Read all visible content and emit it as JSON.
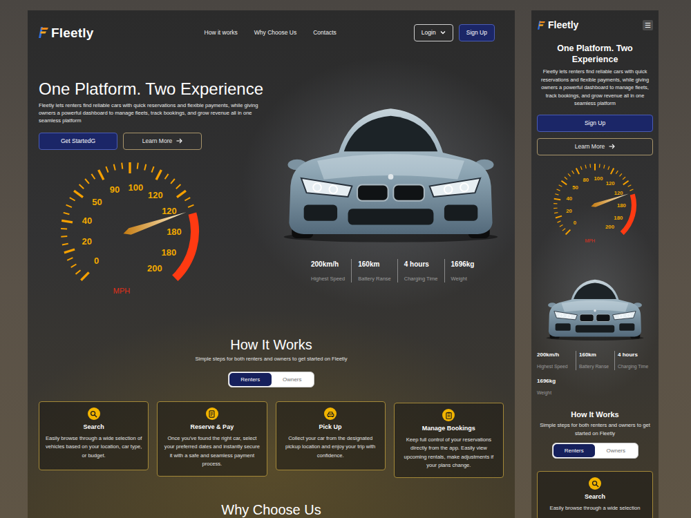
{
  "desktop": {
    "brand": "Fleetly",
    "nav_links": [
      "How it works",
      "Why Choose Us",
      "Contacts"
    ],
    "login_button": "Login",
    "signup_button": "Sign Up",
    "hero": {
      "title": "One Platform. Two Experience",
      "description": "Fleetly lets renters find reliable cars with quick reservations and flexible payments, while giving owners a powerful dashboard to manage fleets, track bookings, and grow revenue all in one seamless platform",
      "primary_button": "Get StartedG",
      "secondary_button": "Learn More"
    },
    "gauge": {
      "labels": [
        "0",
        "20",
        "40",
        "50",
        "90",
        "100",
        "120",
        "120",
        "180",
        "180",
        "200"
      ],
      "unit": "MPH",
      "level": 0.73
    },
    "specs": [
      {
        "value": "200km/h",
        "label": "Highest Speed"
      },
      {
        "value": "160km",
        "label": "Battery Ranse"
      },
      {
        "value": "4 hours",
        "label": "Charging Time"
      },
      {
        "value": "1696kg",
        "label": "Weight"
      }
    ],
    "how_it_works": {
      "title": "How It Works",
      "subtitle": "Simple steps for both renters and owners to get started on Fleetly",
      "tabs": [
        {
          "label": "Renters",
          "selected": true
        },
        {
          "label": "Owners",
          "selected": false
        }
      ],
      "steps": [
        {
          "title": "Search",
          "text": "Easily browse through a wide selection of vehicles based on your location, car type, or budget."
        },
        {
          "title": "Reserve & Pay",
          "text": "Once you've found the right car, select your preferred dates and instantly secure it with a safe and seamless payment process."
        },
        {
          "title": "Pick Up",
          "text": "Collect your car from the designated pickup location and enjoy your trip with confidence."
        },
        {
          "title": "Manage Bookings",
          "text": "Keep full control of your reservations directly from the app. Easily view upcoming rentals, make adjustments if your plans change."
        }
      ]
    },
    "why_choose_us": {
      "title": "Why Choose Us"
    }
  },
  "mobile": {
    "brand": "Fleetly",
    "menu_icon": "☰",
    "hero": {
      "title": "One Platform. Two Experience",
      "description": "Fleetly lets renters find reliable cars with quick reservations and flexible payments, while giving owners a powerful dashboard to manage fleets, track bookings, and grow revenue  all in one seamless platform",
      "primary_button": "Sign Up",
      "secondary_button": "Learn More"
    },
    "gauge": {
      "labels": [
        "0",
        "20",
        "40",
        "50",
        "80",
        "100",
        "120",
        "120",
        "180",
        "180",
        "200"
      ],
      "unit": "MPH",
      "level": 0.73
    },
    "specs": [
      {
        "value": "200km/h",
        "label": "Highest Speed"
      },
      {
        "value": "160km",
        "label": "Battery Ranse"
      },
      {
        "value": "4 hours",
        "label": "Charging Time"
      },
      {
        "value": "1696kg",
        "label": "Weight"
      }
    ],
    "how_it_works": {
      "title": "How It Works",
      "subtitle": "Simple steps for both renters and owners to get started on Fleetly",
      "tabs": [
        {
          "label": "Renters",
          "selected": true
        },
        {
          "label": "Owners",
          "selected": false
        }
      ],
      "steps": [
        {
          "title": "Search",
          "text": "Easily browse through a wide selection"
        }
      ]
    }
  }
}
